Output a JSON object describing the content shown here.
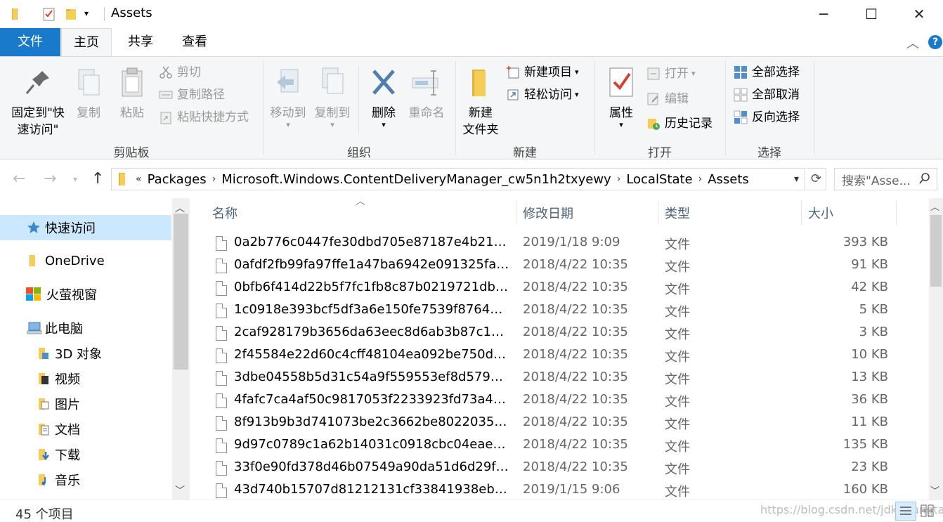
{
  "window": {
    "title": "Assets",
    "controls": {
      "minimize": "─",
      "maximize": "☐",
      "close": "✕"
    }
  },
  "tabs": {
    "file": "文件",
    "home": "主页",
    "share": "共享",
    "view": "查看"
  },
  "ribbon": {
    "clipboard": {
      "label": "剪贴板",
      "pin_line1": "固定到\"快",
      "pin_line2": "速访问\"",
      "copy": "复制",
      "paste": "粘贴",
      "cut": "剪切",
      "copy_path": "复制路径",
      "paste_shortcut": "粘贴快捷方式"
    },
    "organize": {
      "label": "组织",
      "move_to": "移动到",
      "copy_to": "复制到",
      "delete": "删除",
      "rename": "重命名"
    },
    "new": {
      "label": "新建",
      "new_folder_line1": "新建",
      "new_folder_line2": "文件夹",
      "new_item": "新建项目",
      "easy_access": "轻松访问"
    },
    "open": {
      "label": "打开",
      "properties": "属性",
      "open": "打开",
      "edit": "编辑",
      "history": "历史记录"
    },
    "select": {
      "label": "选择",
      "select_all": "全部选择",
      "select_none": "全部取消",
      "invert": "反向选择"
    }
  },
  "address": {
    "overflow": "«",
    "segments": [
      "Packages",
      "Microsoft.Windows.ContentDeliveryManager_cw5n1h2txyewy",
      "LocalState",
      "Assets"
    ],
    "search_placeholder": "搜索\"Asse..."
  },
  "nav": [
    {
      "label": "快速访问",
      "icon": "star-icon"
    },
    {
      "label": "OneDrive",
      "icon": "cloud-folder-icon"
    },
    {
      "label": "火萤视窗",
      "icon": "windows-icon"
    },
    {
      "label": "此电脑",
      "icon": "computer-icon"
    },
    {
      "label": "3D 对象",
      "icon": "cube-folder-icon"
    },
    {
      "label": "视频",
      "icon": "video-folder-icon"
    },
    {
      "label": "图片",
      "icon": "pictures-folder-icon"
    },
    {
      "label": "文档",
      "icon": "documents-folder-icon"
    },
    {
      "label": "下载",
      "icon": "downloads-folder-icon"
    },
    {
      "label": "音乐",
      "icon": "music-folder-icon"
    }
  ],
  "columns": {
    "name": "名称",
    "date": "修改日期",
    "type": "类型",
    "size": "大小"
  },
  "files": [
    {
      "name": "0a2b776c0447fe30dbd705e87187e4b21fd...",
      "date": "2019/1/18 9:09",
      "type": "文件",
      "size": "393 KB"
    },
    {
      "name": "0afdf2fb99fa97ffe1a47ba6942e091325fac8...",
      "date": "2018/4/22 10:35",
      "type": "文件",
      "size": "91 KB"
    },
    {
      "name": "0bfb6f414d22b5f7fc1fb8c87b0219721db4...",
      "date": "2018/4/22 10:35",
      "type": "文件",
      "size": "42 KB"
    },
    {
      "name": "1c0918e393bcf5df3a6e150fe7539f8764eb...",
      "date": "2018/4/22 10:35",
      "type": "文件",
      "size": "5 KB"
    },
    {
      "name": "2caf928179b3656da63eec8d6ab3b87c165...",
      "date": "2018/4/22 10:35",
      "type": "文件",
      "size": "3 KB"
    },
    {
      "name": "2f45584e22d60c4cff48104ea092be750d55...",
      "date": "2018/4/22 10:35",
      "type": "文件",
      "size": "10 KB"
    },
    {
      "name": "3dbe04558b5d31c54a9f559553ef8d579e4...",
      "date": "2018/4/22 10:35",
      "type": "文件",
      "size": "13 KB"
    },
    {
      "name": "4fafc7ca4af50c9817053f2233923fd73a47d...",
      "date": "2018/4/22 10:35",
      "type": "文件",
      "size": "36 KB"
    },
    {
      "name": "8f913b9b3d741073be2c3662be80220351...",
      "date": "2018/4/22 10:35",
      "type": "文件",
      "size": "11 KB"
    },
    {
      "name": "9d97c0789c1a62b14031c0918cbc04eaebf...",
      "date": "2018/4/22 10:35",
      "type": "文件",
      "size": "135 KB"
    },
    {
      "name": "33f0e90fd378d46b07549a90da51d6d29f4...",
      "date": "2018/4/22 10:35",
      "type": "文件",
      "size": "23 KB"
    },
    {
      "name": "43d740b15707d81212131cf33841938eba...",
      "date": "2019/1/15 9:06",
      "type": "文件",
      "size": "160 KB"
    }
  ],
  "status": {
    "count": "45 个项目",
    "watermark": "https://blog.csdn.net/jdk_wangtaida"
  }
}
